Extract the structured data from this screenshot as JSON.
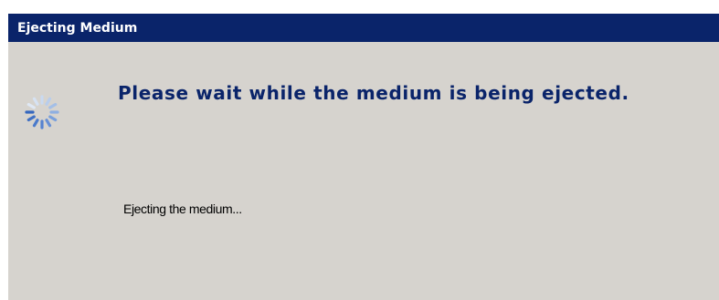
{
  "window": {
    "title": "Ejecting Medium"
  },
  "main": {
    "heading": "Please wait while the medium is being ejected.",
    "status_text": "Ejecting the medium...",
    "spinner_icon": "busy-spinner-icon"
  },
  "colors": {
    "titlebar": "#0a246a",
    "heading_text": "#0a246a",
    "dialog_background": "#d6d3ce",
    "spinner": "#5a8fd8"
  }
}
